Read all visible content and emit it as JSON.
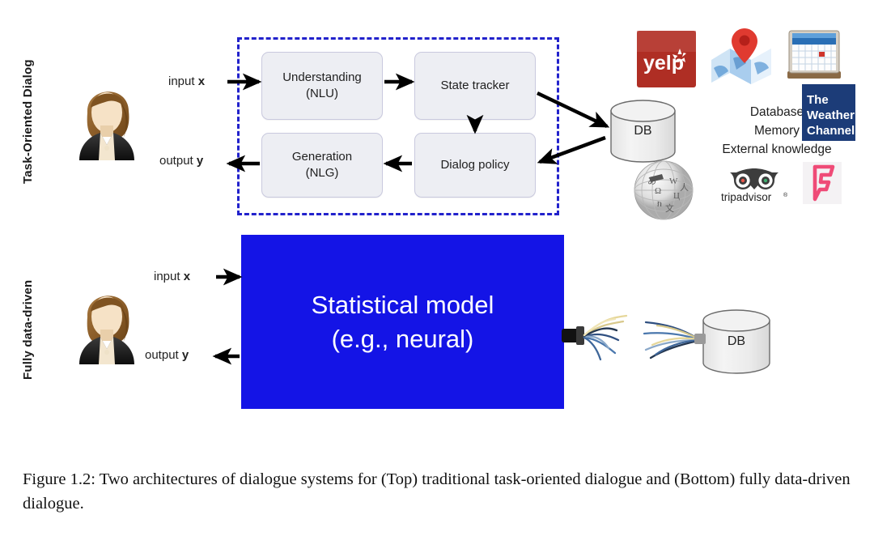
{
  "sections": {
    "top_label": "Task-Oriented Dialog",
    "bottom_label": "Fully data-driven"
  },
  "io": {
    "input_prefix": "input ",
    "input_var": "x",
    "output_prefix": "output ",
    "output_var": "y"
  },
  "pipeline": {
    "nlu": {
      "line1": "Understanding",
      "line2": "(NLU)"
    },
    "state_tracker": {
      "line1": "State tracker",
      "line2": ""
    },
    "nlg": {
      "line1": "Generation",
      "line2": "(NLG)"
    },
    "dialog_policy": {
      "line1": "Dialog policy",
      "line2": ""
    }
  },
  "statistical_model": {
    "line1": "Statistical model",
    "line2": "(e.g., neural)"
  },
  "database": {
    "top_label": "DB",
    "bottom_label": "DB"
  },
  "knowledge": {
    "line1": "Database",
    "line2": "Memory",
    "line3": "External knowledge"
  },
  "logos": [
    {
      "name": "yelp-logo",
      "text": "yelp"
    },
    {
      "name": "map-pin-icon",
      "text": ""
    },
    {
      "name": "calendar-icon",
      "text": ""
    },
    {
      "name": "weather-channel-logo",
      "line1": "The",
      "line2": "Weather",
      "line3": "Channel"
    },
    {
      "name": "wikipedia-globe-logo",
      "text": ""
    },
    {
      "name": "tripadvisor-logo",
      "text": "tripadvisor"
    },
    {
      "name": "foursquare-logo",
      "text": ""
    }
  ],
  "colors": {
    "dashed_border": "#2222CC",
    "statistical_model_bg": "#1414E6",
    "pipeline_box_bg": "#EDEEF3",
    "yelp_red": "#AF2E24",
    "weather_navy": "#1C3C78",
    "foursquare_pink": "#F04878"
  },
  "caption": {
    "label": "Figure 1.2:",
    "text": " Two architectures of dialogue systems for (Top) traditional task-oriented dialogue and (Bottom) fully data-driven dialogue."
  }
}
